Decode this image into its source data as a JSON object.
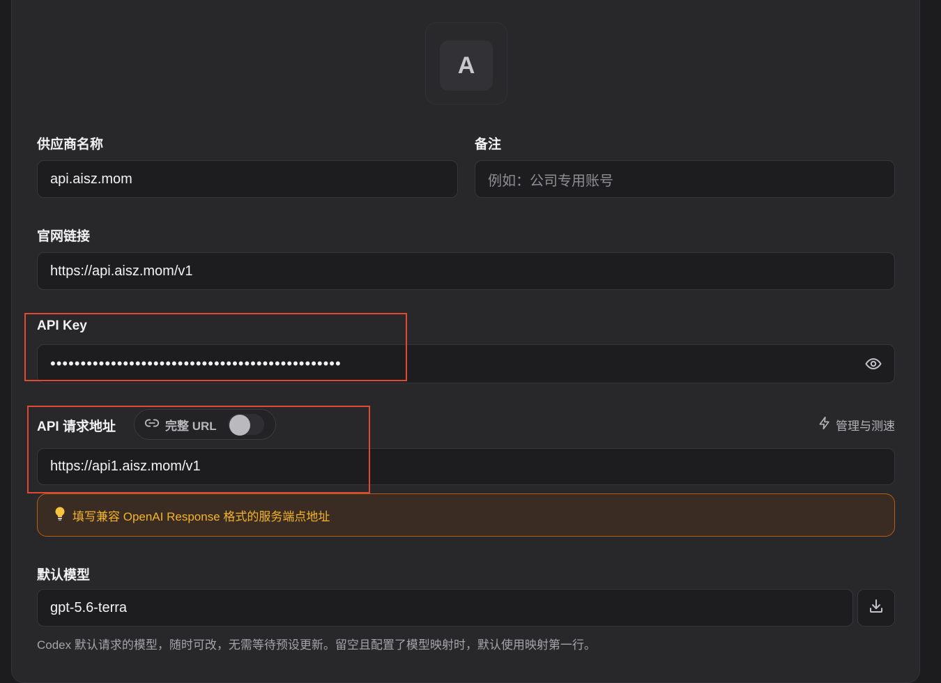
{
  "avatar": {
    "letter": "A"
  },
  "provider": {
    "label": "供应商名称",
    "value": "api.aisz.mom"
  },
  "remark": {
    "label": "备注",
    "placeholder": "例如：公司专用账号"
  },
  "website": {
    "label": "官网链接",
    "value": "https://api.aisz.mom/v1"
  },
  "apikey": {
    "label": "API Key",
    "masked": "••••••••••••••••••••••••••••••••••••••••••••••••"
  },
  "endpoint": {
    "label": "API 请求地址",
    "full_url_label": "完整 URL",
    "full_url_enabled": false,
    "manage_label": "管理与测速",
    "value": "https://api1.aisz.mom/v1"
  },
  "hint": {
    "icon": "lightbulb-icon",
    "text": "填写兼容 OpenAI Response 格式的服务端点地址"
  },
  "model": {
    "label": "默认模型",
    "value": "gpt-5.6-terra",
    "note": "Codex 默认请求的模型，随时可改，无需等待预设更新。留空且配置了模型映射时，默认使用映射第一行。"
  },
  "colors": {
    "accent_red": "#e04a33",
    "hint_orange": "#f4b42a"
  }
}
